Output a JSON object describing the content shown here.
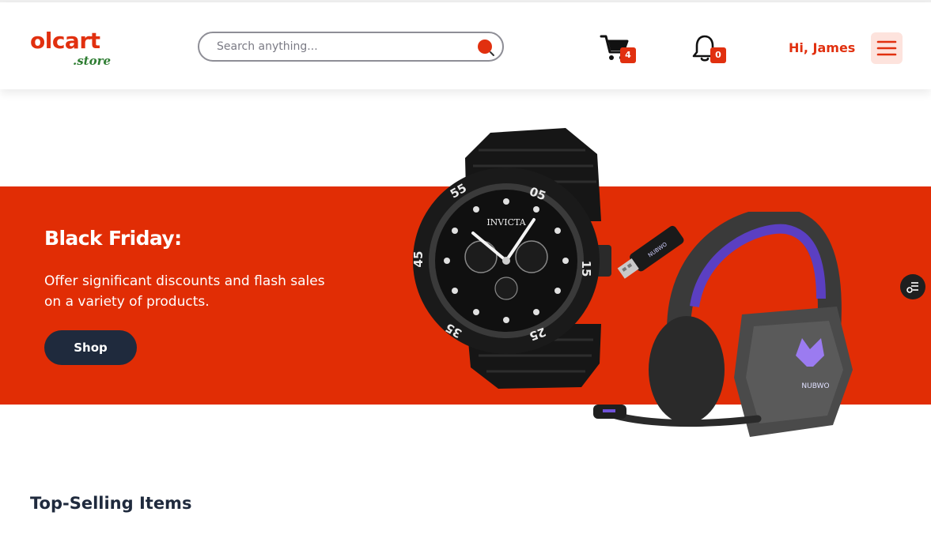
{
  "header": {
    "logo_main": "olcart",
    "logo_sub": ".store",
    "search_placeholder": "Search anything...",
    "cart_icon": "cart-icon",
    "cart_count": "4",
    "bell_icon": "bell-icon",
    "notification_count": "0",
    "greeting": "Hi, James",
    "menu_icon": "hamburger-menu-icon"
  },
  "banner": {
    "title": "Black Friday:",
    "description": "Offer significant discounts and flash sales on a variety of products.",
    "button_label": "Shop",
    "watch_brand": "INVICTA",
    "headset_brand": "NUBWO",
    "dongle_brand": "NUBWO"
  },
  "section": {
    "title": "Top-Selling Items"
  },
  "colors": {
    "brand": "#e1300f",
    "banner_bg": "#e12d05",
    "button_dark": "#1f2a3d",
    "logo_green": "#2e7d32"
  }
}
